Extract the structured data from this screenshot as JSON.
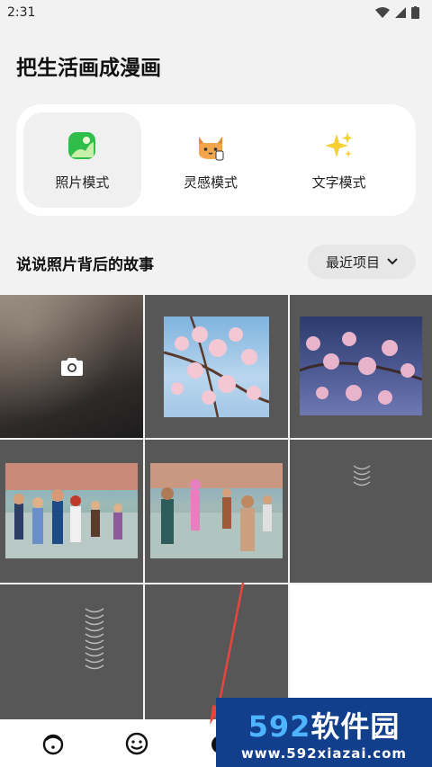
{
  "status_bar": {
    "time": "2:31"
  },
  "header": {
    "title": "把生活画成漫画"
  },
  "modes": [
    {
      "label": "照片模式",
      "icon": "photo-mode-icon",
      "active": true
    },
    {
      "label": "灵感模式",
      "icon": "cat-inspiration-icon",
      "active": false
    },
    {
      "label": "文字模式",
      "icon": "sparkle-text-icon",
      "active": false
    }
  ],
  "section": {
    "title": "说说照片背后的故事",
    "dropdown_label": "最近项目"
  },
  "watermark": {
    "brand_digits": "592",
    "brand_text": "软件园",
    "url": "www.592xiazai.com"
  },
  "colors": {
    "accent_green": "#2fbe4a",
    "watermark_blue": "#123f8c",
    "arrow_red": "#e8453c"
  }
}
